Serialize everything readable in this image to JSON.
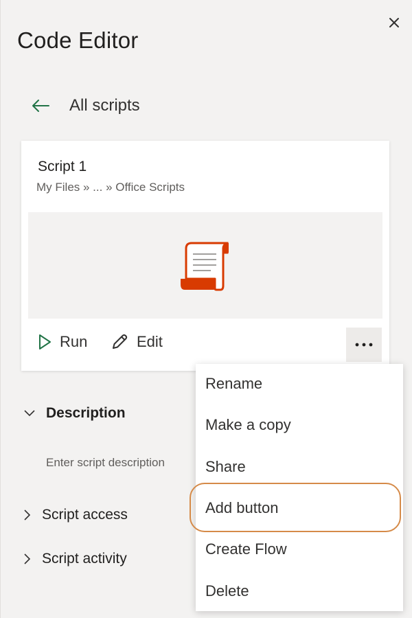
{
  "pane": {
    "title": "Code Editor",
    "close_icon": "close-icon",
    "back_label": "All scripts"
  },
  "script_card": {
    "title": "Script 1",
    "path": "My Files » ... » Office Scripts",
    "preview_icon": "script-scroll-icon",
    "run_label": "Run",
    "edit_label": "Edit",
    "more_icon": "ellipsis-icon"
  },
  "sections": {
    "description_label": "Description",
    "description_placeholder": "Enter script description",
    "access_label": "Script access",
    "activity_label": "Script activity"
  },
  "context_menu": {
    "items": [
      "Rename",
      "Make a copy",
      "Share",
      "Add button",
      "Create Flow",
      "Delete"
    ],
    "highlighted_item": "Add button"
  },
  "colors": {
    "accent_green": "#217346",
    "scroll_orange": "#d83b01",
    "highlight_ring": "#d58a48"
  }
}
